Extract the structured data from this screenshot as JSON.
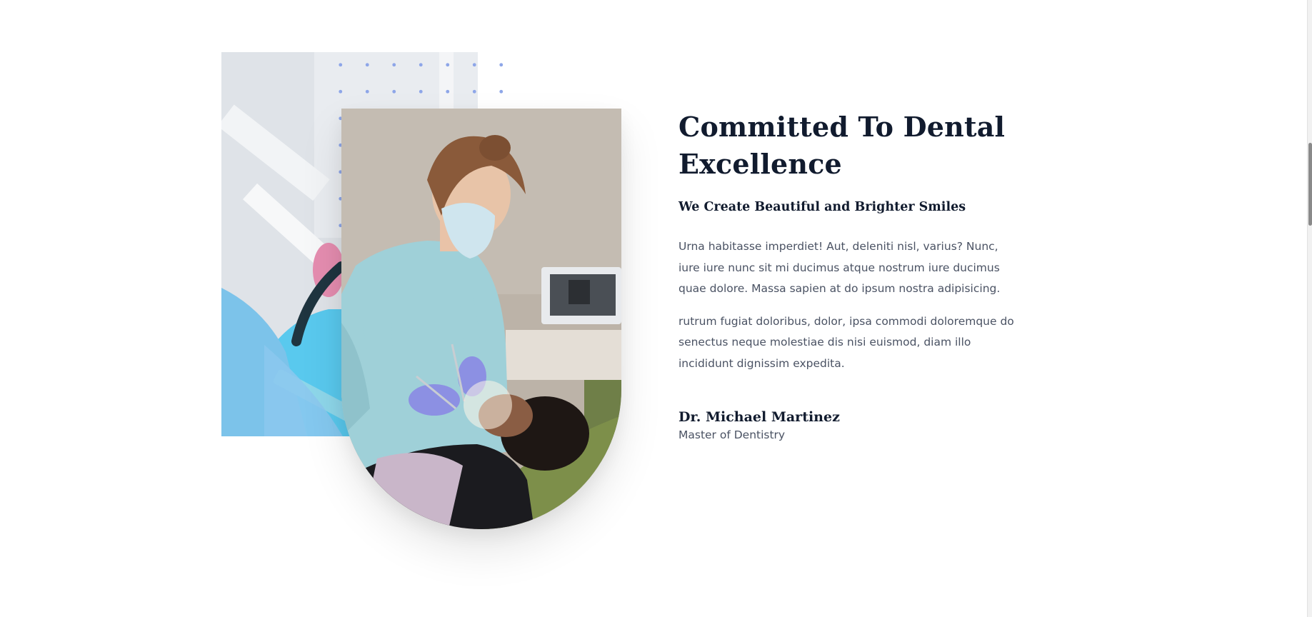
{
  "about": {
    "headline": "Committed To Dental Excellence",
    "subheadline": "We Create Beautiful and Brighter Smiles",
    "paragraphs": [
      "Urna habitasse imperdiet! Aut, deleniti nisl, varius? Nunc, iure iure nunc sit mi ducimus atque nostrum iure ducimus quae dolore. Massa sapien at do ipsum nostra adipisicing.",
      "rutrum fugiat doloribus, dolor, ipsa commodi doloremque do senectus neque molestiae dis nisi euismod, diam illo incididunt dignissim expedita."
    ],
    "author": {
      "name": "Dr. Michael Martinez",
      "title": "Master of Dentistry"
    }
  },
  "images": {
    "back_photo": "dental-chair-photo",
    "front_photo": "dentist-treating-patient-photo",
    "decoration": "dot-grid-pattern"
  },
  "colors": {
    "heading": "#111b2e",
    "body_text": "#4a5263",
    "dot_accent": "#8ea6e8",
    "background": "#ffffff"
  }
}
